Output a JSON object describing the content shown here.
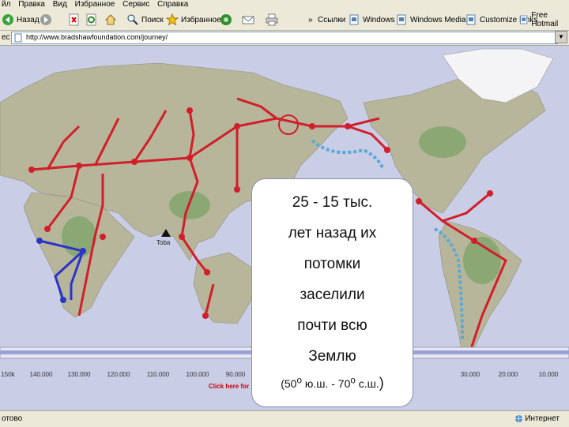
{
  "menubar": [
    "йл",
    "Правка",
    "Вид",
    "Избранное",
    "Сервис",
    "Справка"
  ],
  "toolbar": {
    "back_label": "Назад",
    "search_label": "Поиск",
    "favorites_label": "Избранное",
    "more": "»",
    "links": [
      "Ссылки",
      "Windows",
      "Windows Media",
      "Customize Links",
      "Free Hotmail"
    ]
  },
  "address": {
    "label": "ес",
    "url": "http://www.bradshawfoundation.com/journey/"
  },
  "overlay": {
    "lines": [
      "25 - 15 тыс.",
      "лет назад их",
      "потомки",
      "заселили",
      "почти всю",
      "Землю"
    ],
    "range_pre": "(50",
    "range_deg1": "о",
    "range_mid": " ю.ш. - 70",
    "range_deg2": "о",
    "range_post": " с.ш.",
    "range_close": ")"
  },
  "map": {
    "toba_label": "Toba",
    "click_label": "Click here for",
    "timeline_labels": [
      "150k",
      "140.000",
      "130.000",
      "120.000",
      "110.000",
      "100.000",
      "90.000",
      "30.000",
      "20.000",
      "10.000"
    ],
    "colors": {
      "ocean": "#c9cde6",
      "route": "#d11e2a",
      "blue": "#2b35c9",
      "dashed": "#5aa9d6",
      "green": "#2b7a2b"
    }
  },
  "status": {
    "left": "отово",
    "right": "Интернет"
  }
}
